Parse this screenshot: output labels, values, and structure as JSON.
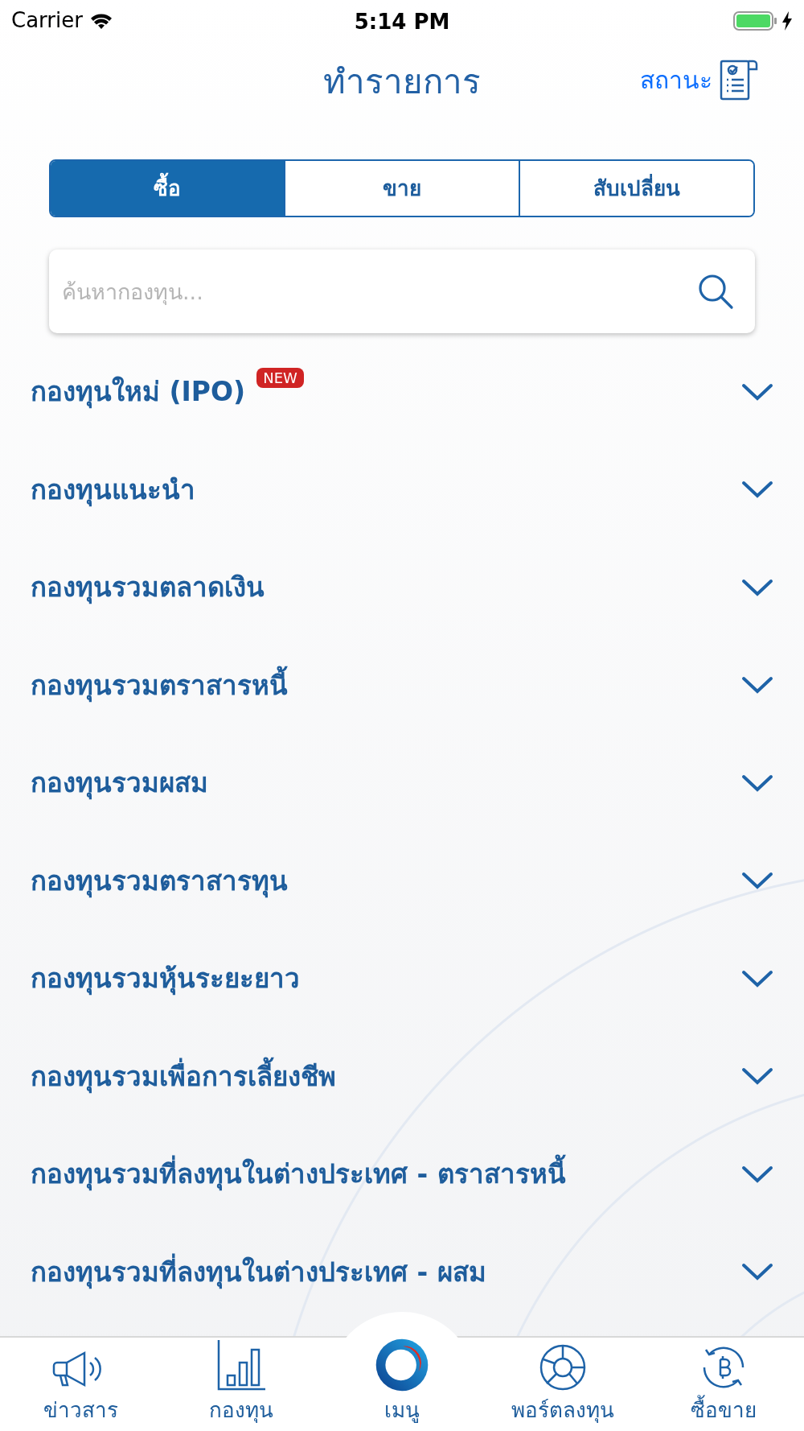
{
  "status_bar": {
    "carrier": "Carrier",
    "time": "5:14 PM"
  },
  "header": {
    "title": "ทำรายการ",
    "status_link": "สถานะ"
  },
  "tabs": [
    {
      "label": "ซื้อ",
      "selected": true
    },
    {
      "label": "ขาย",
      "selected": false
    },
    {
      "label": "สับเปลี่ยน",
      "selected": false
    }
  ],
  "search": {
    "placeholder": "ค้นหากองทุน..."
  },
  "categories": [
    {
      "label": "กองทุนใหม่ (IPO)",
      "badge": "NEW"
    },
    {
      "label": "กองทุนแนะนำ"
    },
    {
      "label": "กองทุนรวมตลาดเงิน"
    },
    {
      "label": "กองทุนรวมตราสารหนี้"
    },
    {
      "label": "กองทุนรวมผสม"
    },
    {
      "label": "กองทุนรวมตราสารทุน"
    },
    {
      "label": "กองทุนรวมหุ้นระยะยาว"
    },
    {
      "label": "กองทุนรวมเพื่อการเลี้ยงชีพ"
    },
    {
      "label": "กองทุนรวมที่ลงทุนในต่างประเทศ - ตราสารหนี้"
    },
    {
      "label": "กองทุนรวมที่ลงทุนในต่างประเทศ - ผสม"
    }
  ],
  "bottom_nav": [
    {
      "kind": "news",
      "label": "ข่าวสาร"
    },
    {
      "kind": "funds",
      "label": "กองทุน"
    },
    {
      "kind": "menu",
      "label": "เมนู"
    },
    {
      "kind": "portfolio",
      "label": "พอร์ตลงทุน"
    },
    {
      "kind": "trade",
      "label": "ซื้อขาย"
    }
  ]
}
